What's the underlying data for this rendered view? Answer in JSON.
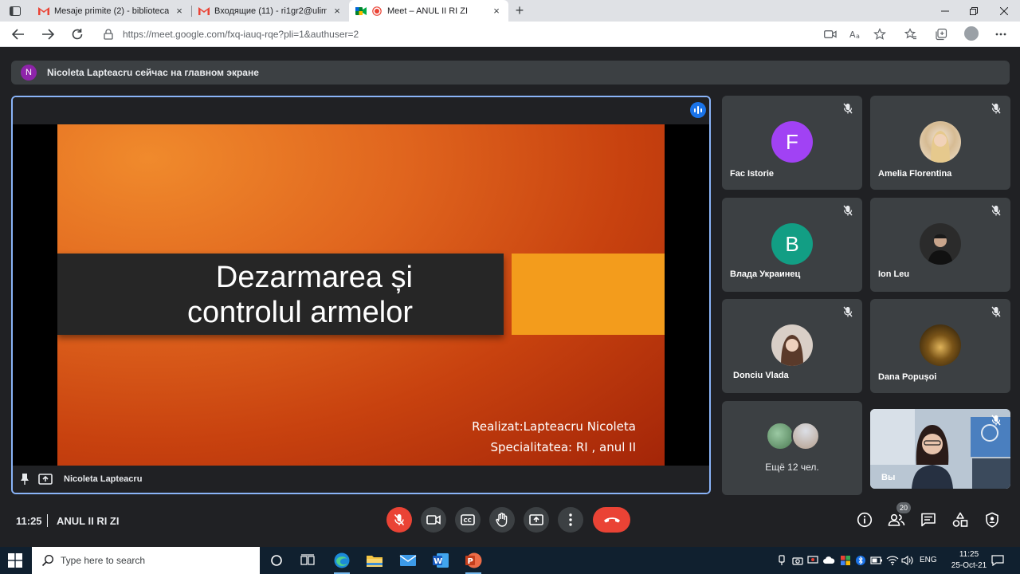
{
  "browser": {
    "tabs": [
      {
        "label": "Mesaje primite (2) - biblioteca@",
        "favicon": "gmail-icon",
        "active": false
      },
      {
        "label": "Входящие (11) - ri1gr2@ulim.m",
        "favicon": "gmail-icon",
        "active": false
      },
      {
        "label": "Meet – ANUL II RI ZI",
        "favicon": "meet-icon",
        "active": true
      }
    ],
    "new_tab": "+",
    "url": "https://meet.google.com/fxq-iauq-rqe?pli=1&authuser=2"
  },
  "meet": {
    "banner": {
      "avatar_letter": "N",
      "text": "Nicoleta Lapteacru сейчас на главном экране"
    },
    "presenter_name": "Nicoleta Lapteacru",
    "slide": {
      "title_line1": "Dezarmarea și",
      "title_line2": "controlul armelor",
      "sub_line1": "Realizat:Lapteacru Nicoleta",
      "sub_line2": "Specialitatea: RI , anul II"
    },
    "participants": [
      {
        "name": "Fac Istorie",
        "avatar_letter": "F",
        "avatar_color": "#a142f4",
        "photo": false
      },
      {
        "name": "Amelia Florentina",
        "avatar_letter": "",
        "avatar_color": "#d9c9b0",
        "photo": true
      },
      {
        "name": "Влада Украинец",
        "avatar_letter": "В",
        "avatar_color": "#129e84",
        "photo": false
      },
      {
        "name": "Ion Leu",
        "avatar_letter": "",
        "avatar_color": "#2a2a2a",
        "photo": true
      },
      {
        "name": "Donciu Vlada",
        "avatar_letter": "",
        "avatar_color": "#6b4a3a",
        "photo": true
      },
      {
        "name": "Dana Popușoi",
        "avatar_letter": "",
        "avatar_color": "#6e5420",
        "photo": true
      }
    ],
    "more_participants": "Ещё 12 чел.",
    "self_label": "Вы",
    "time": "11:25",
    "meeting_name": "ANUL II RI ZI",
    "participant_count": "20"
  },
  "taskbar": {
    "search_placeholder": "Type here to search",
    "lang": "ENG",
    "time": "11:25",
    "date": "25-Oct-21"
  }
}
